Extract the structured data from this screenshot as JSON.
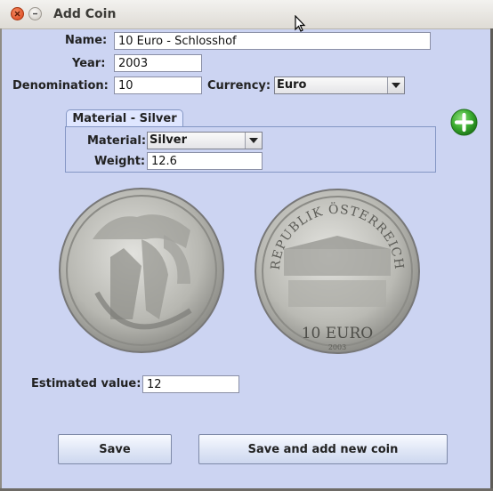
{
  "window": {
    "title": "Add Coin"
  },
  "form": {
    "name_label": "Name:",
    "name_value": "10 Euro - Schlosshof",
    "year_label": "Year:",
    "year_value": "2003",
    "denomination_label": "Denomination:",
    "denomination_value": "10",
    "currency_label": "Currency:",
    "currency_value": "Euro"
  },
  "material_tab": {
    "tab_label": "Material - Silver",
    "material_label": "Material:",
    "material_value": "Silver",
    "weight_label": "Weight:",
    "weight_value": "12.6"
  },
  "images": {
    "obverse": {
      "icon": "coin-obverse-image",
      "color": "#b9b9b3"
    },
    "reverse": {
      "icon": "coin-reverse-image",
      "color": "#b9b9b3",
      "inscription_top": "REPUBLIK ÖSTERREICH",
      "inscription_value": "10 EURO",
      "inscription_year": "2003"
    }
  },
  "estimate": {
    "label": "Estimated value:",
    "value": "12"
  },
  "buttons": {
    "save": "Save",
    "save_and_new": "Save and add new coin"
  },
  "colors": {
    "background": "#ccd4f2",
    "add_icon": "#2e9f2e"
  }
}
